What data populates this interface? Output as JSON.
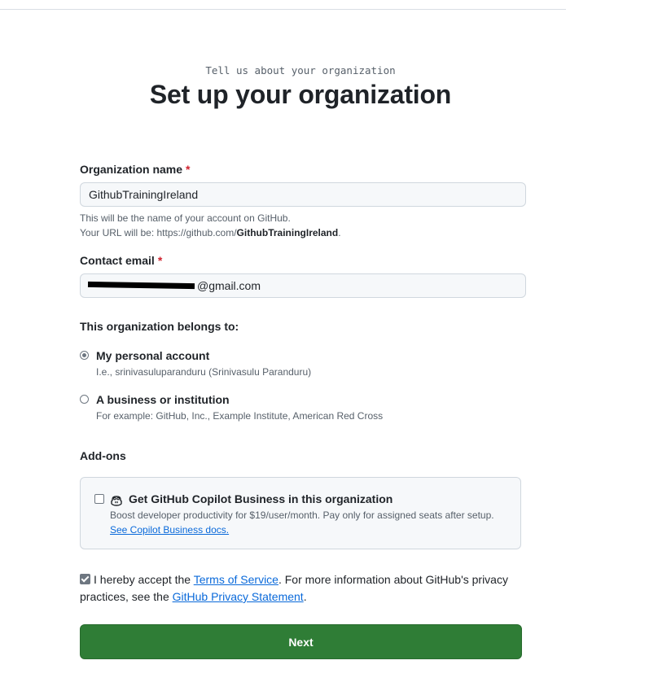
{
  "header": {
    "eyebrow": "Tell us about your organization",
    "title": "Set up your organization"
  },
  "org_name": {
    "label": "Organization name",
    "required_mark": "*",
    "value": "GithubTrainingIreland",
    "hint_line1": "This will be the name of your account on GitHub.",
    "hint_line2_prefix": "Your URL will be: https://github.com/",
    "hint_line2_bold": "GithubTrainingIreland",
    "hint_line2_suffix": "."
  },
  "contact_email": {
    "label": "Contact email",
    "required_mark": "*",
    "visible_value": "@gmail.com"
  },
  "belongs_to": {
    "label": "This organization belongs to:",
    "options": [
      {
        "title": "My personal account",
        "subtitle": "I.e., srinivasuluparanduru (Srinivasulu Paranduru)",
        "selected": true
      },
      {
        "title": "A business or institution",
        "subtitle": "For example: GitHub, Inc., Example Institute, American Red Cross",
        "selected": false
      }
    ]
  },
  "addons": {
    "label": "Add-ons",
    "copilot_icon": "copilot-icon",
    "copilot_title": "Get GitHub Copilot Business in this organization",
    "copilot_desc": "Boost developer productivity for $19/user/month. Pay only for assigned seats after setup.",
    "copilot_link": "See Copilot Business docs.",
    "checked": false
  },
  "terms": {
    "checked": true,
    "prefix": "I hereby accept the ",
    "tos_link": "Terms of Service",
    "middle": ". For more information about GitHub's privacy practices, see the ",
    "privacy_link": "GitHub Privacy Statement",
    "suffix": "."
  },
  "next_button": {
    "label": "Next",
    "color": "#2f7d36"
  }
}
